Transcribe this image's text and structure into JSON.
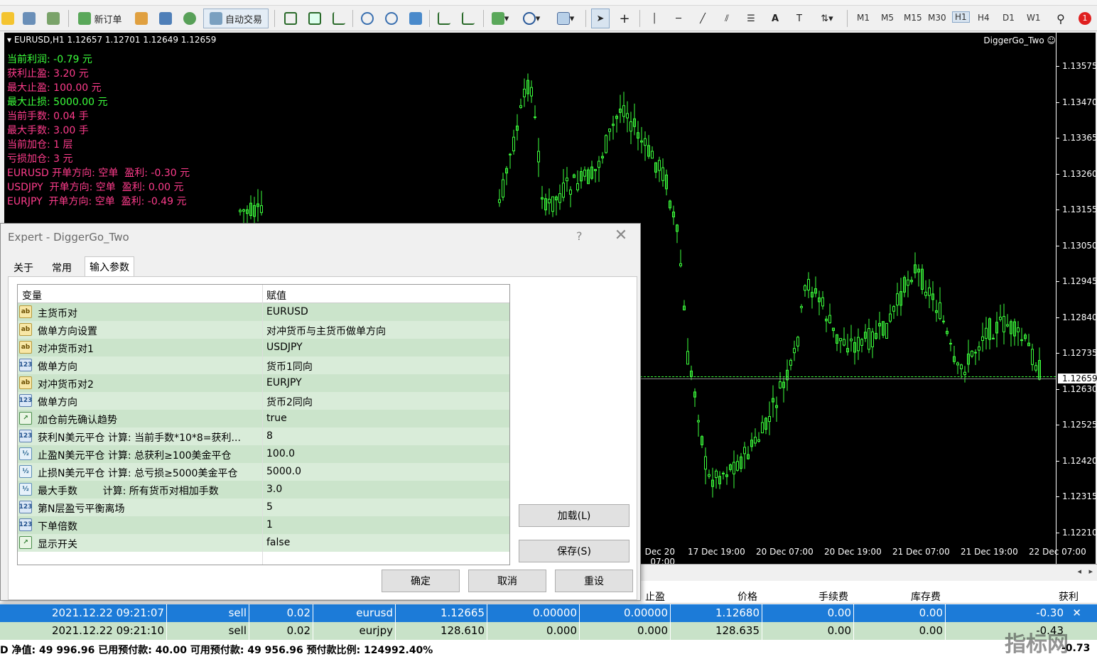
{
  "toolbar": {
    "new_order": "新订单",
    "auto_trade": "自动交易",
    "timeframes": [
      "M1",
      "M5",
      "M15",
      "M30",
      "H1",
      "H4",
      "D1",
      "W1"
    ],
    "active_timeframe": "H1",
    "notification_count": "1"
  },
  "chart": {
    "header": "EURUSD,H1  1.12657 1.12701 1.12649 1.12659",
    "ea_name": "DiggerGo_Two ☺",
    "overlay": [
      {
        "text": "当前利润: -0.79 元",
        "color": "#3cff3c"
      },
      {
        "text": "获利止盈: 3.20 元",
        "color": "#ff3c8c"
      },
      {
        "text": "最大止盈: 100.00 元",
        "color": "#ff3c8c"
      },
      {
        "text": "最大止损: 5000.00 元",
        "color": "#3cff3c"
      },
      {
        "text": "当前手数: 0.04 手",
        "color": "#ff3c8c"
      },
      {
        "text": "最大手数: 3.00 手",
        "color": "#ff3c8c"
      },
      {
        "text": "当前加仓: 1 层",
        "color": "#ff3c8c"
      },
      {
        "text": "亏损加仓: 3 元",
        "color": "#ff3c8c"
      },
      {
        "text": "EURUSD 开单方向: 空单  盈利: -0.30 元",
        "color": "#ff3c8c"
      },
      {
        "text": "USDJPY  开单方向: 空单  盈利: 0.00 元",
        "color": "#ff3c8c"
      },
      {
        "text": "EURJPY  开单方向: 空单  盈利: -0.49 元",
        "color": "#ff3c8c"
      }
    ],
    "price_ticks": [
      "1.13575",
      "1.13470",
      "1.13365",
      "1.13260",
      "1.13155",
      "1.13050",
      "1.12945",
      "1.12840",
      "1.12735",
      "1.12630",
      "1.12525",
      "1.12420",
      "1.12315",
      "1.12210"
    ],
    "current_price": "1.12659",
    "time_ticks": [
      "20 Dec 07:00",
      "17 Dec 19:00",
      "20 Dec 07:00",
      "20 Dec 19:00",
      "21 Dec 07:00",
      "21 Dec 19:00",
      "22 Dec 07:00"
    ],
    "candle_color": "#3cff3c"
  },
  "dialog": {
    "title": "Expert - DiggerGo_Two",
    "help": "?",
    "close": "✕",
    "tabs": [
      "关于",
      "常用",
      "输入参数"
    ],
    "active_tab": "输入参数",
    "col_variable": "变量",
    "col_value": "赋值",
    "params": [
      {
        "type": "str",
        "icon": "ab",
        "name": "主货币对",
        "value": "EURUSD"
      },
      {
        "type": "str",
        "icon": "ab",
        "name": "做单方向设置",
        "value": "对冲货币与主货币做单方向"
      },
      {
        "type": "str",
        "icon": "ab",
        "name": "对冲货币对1",
        "value": "USDJPY"
      },
      {
        "type": "int",
        "icon": "123",
        "name": "做单方向",
        "value": "货币1同向"
      },
      {
        "type": "str",
        "icon": "ab",
        "name": "对冲货币对2",
        "value": "EURJPY"
      },
      {
        "type": "int",
        "icon": "123",
        "name": "做单方向",
        "value": "货币2同向"
      },
      {
        "type": "bool",
        "icon": "↗",
        "name": "加仓前先确认趋势",
        "value": "true"
      },
      {
        "type": "int",
        "icon": "123",
        "name": "获利N美元平仓 计算: 当前手数*10*8=获利...",
        "value": "8"
      },
      {
        "type": "dbl",
        "icon": "½",
        "name": "止盈N美元平仓 计算: 总获利≥100美金平仓",
        "value": "100.0"
      },
      {
        "type": "dbl",
        "icon": "½",
        "name": "止损N美元平仓 计算: 总亏损≥5000美金平仓",
        "value": "5000.0"
      },
      {
        "type": "dbl",
        "icon": "½",
        "name": "最大手数        计算: 所有货币对相加手数",
        "value": "3.0"
      },
      {
        "type": "int",
        "icon": "123",
        "name": "第N层盈亏平衡离场",
        "value": "5"
      },
      {
        "type": "int",
        "icon": "123",
        "name": "下单倍数",
        "value": "1"
      },
      {
        "type": "bool",
        "icon": "↗",
        "name": "显示开关",
        "value": "false"
      }
    ],
    "load_button": "加载(L)",
    "save_button": "保存(S)",
    "ok_button": "确定",
    "cancel_button": "取消",
    "reset_button": "重设"
  },
  "terminal": {
    "headers": {
      "sl": "止盈",
      "price": "价格",
      "commission": "手续费",
      "swap": "库存费",
      "profit": "获利"
    },
    "rows": [
      {
        "time": "2021.12.22 09:21:07",
        "type": "sell",
        "volume": "0.02",
        "symbol": "eurusd",
        "open": "1.12665",
        "sl": "0.00000",
        "tp": "0.00000",
        "price": "1.12680",
        "commission": "0.00",
        "swap": "0.00",
        "profit": "-0.30"
      },
      {
        "time": "2021.12.22 09:21:10",
        "type": "sell",
        "volume": "0.02",
        "symbol": "eurjpy",
        "open": "128.610",
        "sl": "0.000",
        "tp": "0.000",
        "price": "128.635",
        "commission": "0.00",
        "swap": "0.00",
        "profit": "-0.43"
      }
    ],
    "status": "D  净值: 49 996.96  已用预付款: 40.00  可用预付款: 49 956.96  预付款比例: 124992.40%",
    "status_right": "-0.73",
    "watermark": "指标网"
  }
}
